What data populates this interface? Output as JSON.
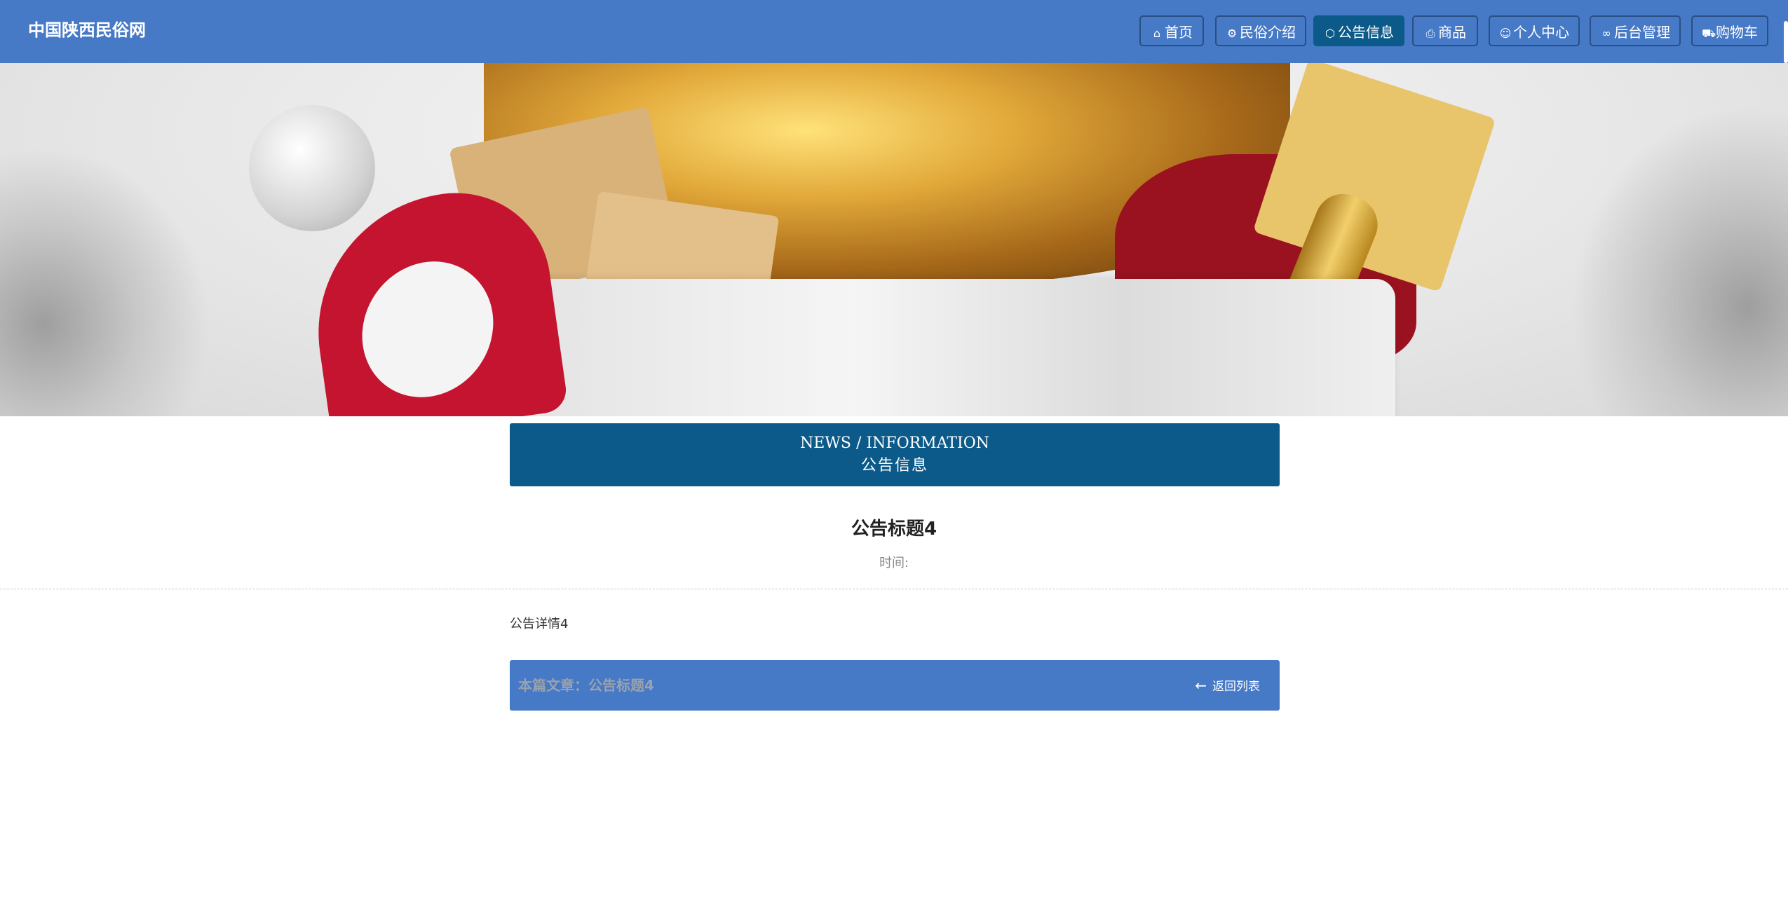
{
  "header": {
    "site_title": "中国陕西民俗网",
    "nav": [
      {
        "label": "首页",
        "icon": "home-icon",
        "glyph": "⌂",
        "active": false
      },
      {
        "label": "民俗介绍",
        "icon": "settings-icon",
        "glyph": "⚙",
        "active": false
      },
      {
        "label": "公告信息",
        "icon": "cube-icon",
        "glyph": "⬡",
        "active": true
      },
      {
        "label": "商品",
        "icon": "printer-icon",
        "glyph": "⎙",
        "active": false
      },
      {
        "label": "个人中心",
        "icon": "user-icon",
        "glyph": "☺",
        "active": false
      },
      {
        "label": "后台管理",
        "icon": "link-icon",
        "glyph": "∞",
        "active": false
      },
      {
        "label": "购物车",
        "icon": "cart-icon",
        "glyph": "⛟",
        "active": false
      }
    ]
  },
  "banner": {
    "indicator_count": 3,
    "active_index": 0
  },
  "section": {
    "title_en": "NEWS / INFORMATION",
    "title_cn": "公告信息"
  },
  "article": {
    "title": "公告标题4",
    "time_label": "时间:",
    "content": "公告详情4"
  },
  "footer": {
    "current_article": "本篇文章：公告标题4",
    "back_label": "返回列表"
  },
  "colors": {
    "primary": "#4679c6",
    "accent_dark": "#0b5a8a"
  }
}
